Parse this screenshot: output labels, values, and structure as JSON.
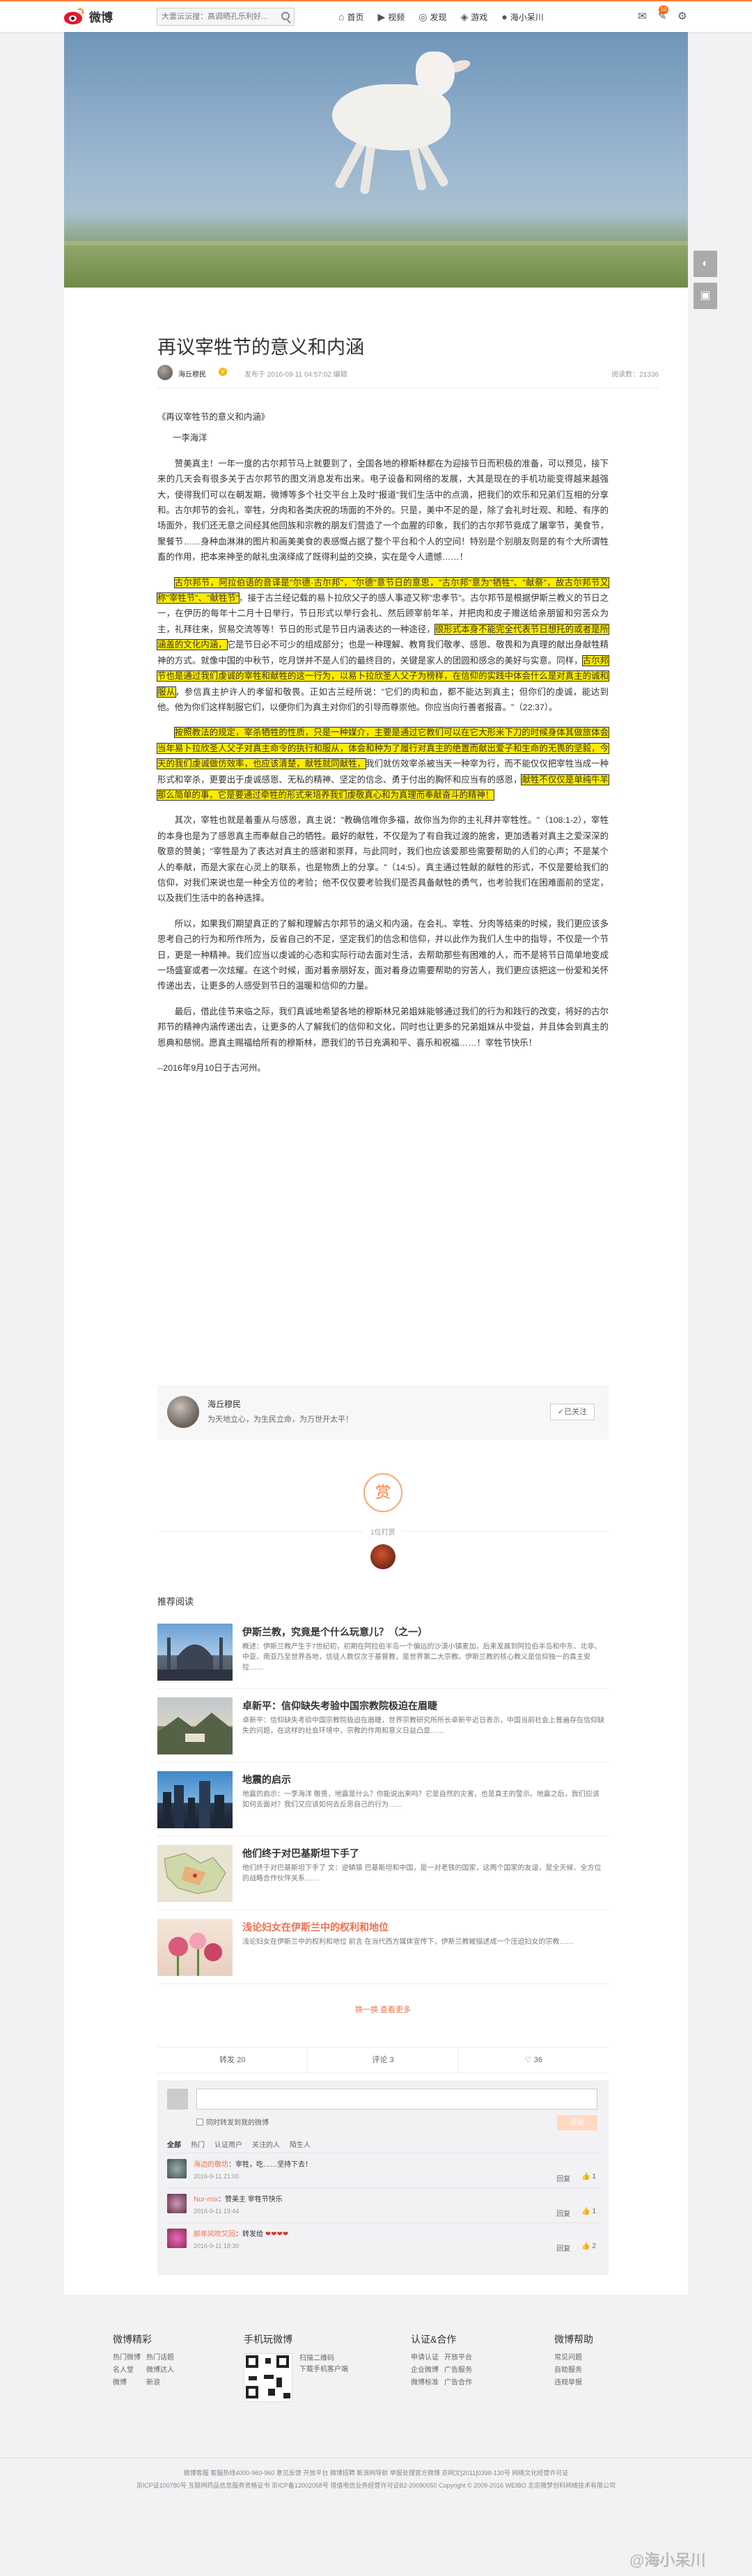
{
  "header": {
    "logo_text": "微博",
    "search_placeholder": "大雲沄沄搜：高调晒孔乐利好...",
    "nav": [
      {
        "icon": "⌂",
        "label": "首页"
      },
      {
        "icon": "▶",
        "label": "视频"
      },
      {
        "icon": "◎",
        "label": "发现"
      },
      {
        "icon": "◈",
        "label": "游戏"
      },
      {
        "icon": "●",
        "label": "海小呆川"
      }
    ],
    "right_icons": [
      "✉",
      "✎",
      "⚙"
    ],
    "msg_badge": "10"
  },
  "float_buttons": [
    "◐",
    "▣"
  ],
  "article": {
    "title": "再议宰牲节的意义和内涵",
    "author": "海丘穆民",
    "pubinfo": "发布于 2016-09-11 04:57:02    编辑",
    "read_count": "阅读数：21336",
    "paragraphs": {
      "p1": "《再议宰牲节的意义和内涵》",
      "p2": "一李海洋",
      "p3": "赞美真主！一年一度的古尔邦节马上就要到了，全国各地的穆斯林都在为迎接节日而积极的准备，可以预见，接下来的几天会有很多关于古尔邦节的图文消息发布出来。电子设备和网络的发展，大其是现在的手机功能变得越来越强大，使得我们可以在朝发期，微博等多个社交平台上及时\"报道\"我们生活中的点滴，把我们的欢乐和兄弟们互相的分享和。古尔邦节的会礼，宰牲，分肉和各类庆祝的场面的不外的。只是，美中不足的是，除了会礼时壮观、和睦、有序的场面外，我们还无意之间经其他回族和宗教的朋友们营造了一个血腥的印象，我们的古尔邦节竟成了屠宰节，美食节，聚餐节……身种血淋淋的图片和画美美食的表感慨占据了整个平台和个人的空间！特别是个别朋友则是的有个大所谓牲畜的作用，把本来神圣的献礼虫演绎成了既得利益的交换，实在是令人遗憾……！",
      "p4_parts": [
        {
          "text": "古尔邦节，阿拉伯语的音译是\"尔德·古尔邦\"，\"尔德\"意节日的意思，\"古尔邦\"意为\"牺牲\"、\"献祭\"，故古尔邦节又称\"宰牲节\"、\"献牲节\"",
          "hl": true
        },
        {
          "text": "，接于古兰经记载的易卜拉欣父子的感人事迹又称\"忠孝节\"。古尔邦节是根据伊斯兰教义的节日之一，在伊历的每年十二月十日举行，节日形式以举行会礼、然后顾宰前年羊，并把肉和皮子赠送给亲朋留和穷苦众为主，礼拜往来，贸易交流等等！节日的形式是节日内涵表达的一种途径，",
          "hl": false
        },
        {
          "text": "很形式本身不能完全代表节日想托的或者是所涵盖的文化内涵，",
          "hl": true
        },
        {
          "text": "它是节日必不可少的组成部分；也是一种理解、教育我们敬孝、感恩、敬畏和为真理的献出身献牲精神的方式。就像中国的中秋节，吃月饼并不是人们的最终目的，关键是家人的团圆和感念的美好与实意。同样，",
          "hl": false
        },
        {
          "text": "古尔邦节也是通过我们虔诚的宰牲和献牲的这一行为，以易卜拉欣圣人父子为榜样，在信仰的实践中体会什么是对真主的诚和服从",
          "hl": true
        },
        {
          "text": "，参信真主护许人的孝留和敬畏。正如古兰经所说：\"它们的肉和血，都不能达到真主；但你们的虔诚，能达到他。他为你们这样制服它们，以便你们为真主对你们的引导而尊崇他。你应当向行善者报喜。\"（22:37）。",
          "hl": false
        }
      ],
      "p5_parts": [
        {
          "text": "按照教法的规定，宰杀牺牲的性质，只是一种媒介，主要是通过它教们可以在它大形米下刀的时候身体其做旅体会当年易卜拉欣圣人父子对真主命令的执行和服从，体会和种为了履行对真主的绝置而献出爱子和生命的无畏的坚毅，今天的我们虔诚做仿效率，也应该清楚，献牲就同献牲，",
          "hl": true
        },
        {
          "text": "我们就仿效宰杀被当天一种宰为行，而不能仅仅把宰牲当成一种形式和宰杀，更要出于虔诚感恩、无私的精神、坚定的信念、勇于付出的胸怀和应当有的感恩，",
          "hl": false
        },
        {
          "text": "献牲不仅仅是单纯牛羊那么简单的事，它是要通过牵牲的形式来培养我们虔敬真心和为真理而奉献奋斗的精神！",
          "hl": true
        }
      ],
      "p6": "其次，宰牲也就是着重从与感恩，真主说：\"教确信唯你多福，故你当为你的主礼拜并宰牲性。\"（108:1-2），宰牲的本身也是为了感恩真主而奉献自己的牺牲。最好的献牲，不仅是为了有自我过渡的施舍，更加透着对真主之爱深深的敬意的赞美；\"宰牲是为了表达对真主的感谢和崇拜，与此同时，我们也应该爱那些需要帮助的人们的心声；不是某个人的奉献，而是大家在心灵上的联系，也是物质上的分享。\"（14:5）。真主通过牲献的献牲的形式，不仅是要给我们的信仰，对我们来说也是一种全方位的考验；他不仅仅要考验我们是否具备献牲的勇气，也考验我们在困难面前的坚定，以及我们生活中的各种选择。",
      "p7": "所以，如果我们期望真正的了解和理解古尔邦节的涵义和内涵，在会礼、宰牲、分肉等结束的时候，我们更应该多思考自己的行为和所作所为，反省自己的不足，坚定我们的信念和信仰，并以此作为我们人生中的指导，不仅是一个节日，更是一种精神。我们应当以虔诚的心态和实际行动去面对生活，去帮助那些有困难的人，而不是将节日简单地变成一场盛宴或者一次炫耀。在这个时候，面对着亲朋好友，面对着身边需要帮助的穷苦人，我们更应该把这一份爱和关怀传递出去，让更多的人感受到节日的温暖和信仰的力量。",
      "p8": "最后，借此佳节来临之际，我们真诚地希望各地的穆斯林兄弟姐妹能够通过我们的行为和践行的改变，将好的古尔邦节的精神内涵传递出去，让更多的人了解我们的信仰和文化，同时也让更多的兄弟姐妹从中受益，并且体会到真主的恩典和慈悯。愿真主赐福给所有的穆斯林，愿我们的节日充满和平、喜乐和祝福……！宰牲节快乐！",
      "p9": "--2016年9月10日于古河州。"
    }
  },
  "author_card": {
    "name": "海丘穆民",
    "desc": "为天地立心，为生民立命，为万世开太平！",
    "follow": "✓已关注"
  },
  "reward": {
    "button": "赏",
    "count_text": "1位打赏"
  },
  "recommend": {
    "label": "推荐阅读",
    "items": [
      {
        "title": "伊斯兰教，究竟是个什么玩意儿？（之一）",
        "snippet": "概述：伊斯兰教产生于7世纪初，初期在阿拉伯半岛一个偏远的沙漠小镇麦加，后来发展到阿拉伯半岛和中东、北非、中亚、南亚乃至世界各地，信徒人数仅次于基督教，是世界第二大宗教。伊斯兰教的核心教义是信仰独一的真主安拉……",
        "thumb": "mosque"
      },
      {
        "title": "卓新平：信仰缺失考验中国宗教院极迫在眉睫",
        "snippet": "卓新平：信仰缺失考验中国宗教院极迫在眉睫，世界宗教研究所所长卓新平近日表示，中国当前社会上普遍存在信仰缺失的问题，在这样的社会环境中，宗教的作用和意义日益凸显……",
        "thumb": "landscape"
      },
      {
        "title": "地震的启示",
        "snippet": "地震的启示：一李海洋 敬畏，地震是什么？你能说出来吗？它是自然的灾害，也是真主的警示。地震之后，我们应该如何去面对？我们又应该如何去反思自己的行为……",
        "thumb": "city"
      },
      {
        "title": "他们终于对巴基斯坦下手了",
        "snippet": "他们终于对巴基斯坦下手了 文：逆鳞猿 巴基斯坦和中国，是一对老铁的国家，这两个国家的友谊，是全天候、全方位的战略合作伙伴关系……",
        "thumb": "map"
      },
      {
        "title": "浅论妇女在伊斯兰中的权利和地位",
        "snippet": "浅论妇女在伊斯兰中的权利和地位 前言 在当代西方媒体宣传下，伊斯兰教被描述成一个压迫妇女的宗教……",
        "thumb": "flowers"
      }
    ],
    "more": "换一换 查看更多"
  },
  "actions": {
    "repost": "转发 20",
    "comment": "评论 3",
    "like": "♡ 36"
  },
  "comments": {
    "checkbox": "同时转发到我的微博",
    "submit": "评论",
    "tabs": [
      "全部",
      "热门",
      "认证用户",
      "关注的人",
      "陌生人"
    ],
    "items": [
      {
        "user": "海边的敬坊",
        "text": "：宰牲，吃……坚持下去！",
        "time": "2016-9-11 21:00",
        "reply": "回复",
        "like": "1"
      },
      {
        "user": "Nur-mix",
        "text": "：赞美主 宰牲节快乐",
        "time": "2016-9-11 19:44",
        "reply": "回复",
        "like": "1"
      },
      {
        "user": "那年风吹又回",
        "text": "：转发给 ",
        "hearts": "❤❤❤❤",
        "time": "2016-9-11 18:30",
        "reply": "回复",
        "like": "2"
      }
    ]
  },
  "footer": {
    "cols": [
      {
        "title": "微博精彩",
        "links": [
          "热门微博",
          "热门话题",
          "名人堂",
          "微博达人",
          "微博",
          "新浪"
        ]
      },
      {
        "title": "手机玩微博",
        "links": [
          "扫描二维码",
          "下载手机客户端"
        ]
      },
      {
        "title": "认证&合作",
        "links": [
          "申请认证",
          "开放平台",
          "企业微博",
          "广告服务",
          "微博标准",
          "广告合作"
        ]
      },
      {
        "title": "微博帮助",
        "links": [
          "常见问题",
          "自助服务",
          "违规举报"
        ]
      }
    ],
    "line1": "微博客服   客服热线4000-960-960   意见反馈   开放平台   微博招聘   新浪网导航   举报处理官方微博   京网文[2011]0398-130号   网络文化经营许可证",
    "line2": "京ICP证100780号   互联网药品信息服务资格证书   京ICP备12002058号   增值电信业务经营许可证B2-20090050   Copyright © 2009-2016 WEIBO 北京微梦创科网络技术有限公司",
    "watermark": "@海小呆川"
  }
}
